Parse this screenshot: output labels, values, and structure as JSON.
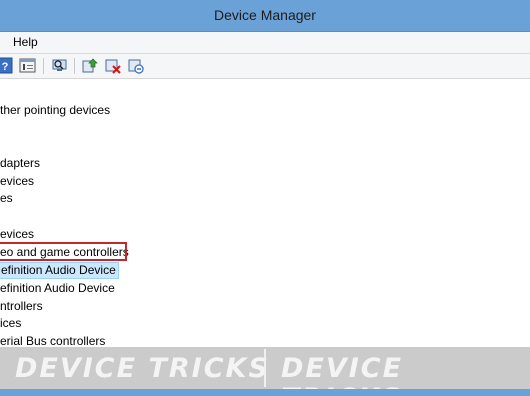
{
  "window": {
    "title": "Device Manager"
  },
  "menu": {
    "items": [
      {
        "label": "Help"
      }
    ]
  },
  "toolbar": {
    "icons": [
      "help-icon",
      "properties-icon",
      "scan-hardware-icon",
      "update-driver-icon",
      "disable-device-icon",
      "uninstall-device-icon"
    ]
  },
  "tree": {
    "items": [
      {
        "label": "ther pointing devices"
      },
      {
        "label": "dapters"
      },
      {
        "label": "evices"
      },
      {
        "label": "es"
      },
      {
        "label": "evices"
      },
      {
        "label": "eo and game controllers",
        "highlighted": true
      },
      {
        "label": "efinition Audio Device",
        "selected": true
      },
      {
        "label": "efinition Audio Device"
      },
      {
        "label": "ntrollers"
      },
      {
        "label": "ices"
      },
      {
        "label": "erial Bus controllers"
      }
    ]
  },
  "watermark": {
    "left": "DEVICE TRICKS",
    "right": "DEVICE TRICKS"
  },
  "colors": {
    "titlebar": "#6aa1d6",
    "selection": "#cce8ff",
    "highlight_border": "#c0282b"
  }
}
